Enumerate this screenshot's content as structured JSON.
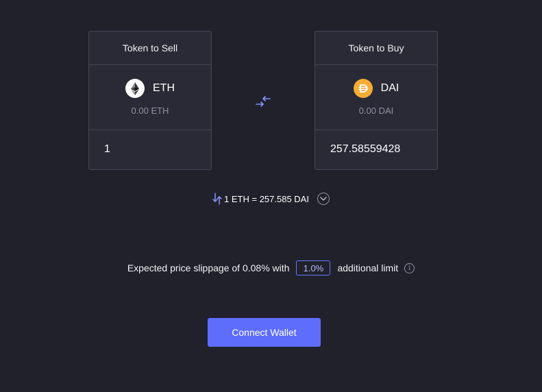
{
  "sell": {
    "header": "Token to Sell",
    "symbol": "ETH",
    "balance": "0.00 ETH",
    "amount": "1",
    "icon": "ethereum-logo-icon"
  },
  "buy": {
    "header": "Token to Buy",
    "symbol": "DAI",
    "balance": "0.00 DAI",
    "amount": "257.58559428",
    "icon": "dai-logo-icon"
  },
  "swap": {
    "icon": "swap-arrows-icon"
  },
  "rate": {
    "text": "1 ETH = 257.585 DAI",
    "flip_icon": "swap-vertical-icon",
    "expand_icon": "chevron-down-icon"
  },
  "slippage": {
    "prefix": "Expected price slippage of 0.08% with",
    "limit_value": "1.0%",
    "suffix": "additional limit",
    "info_icon": "info-icon"
  },
  "connect_button": "Connect Wallet",
  "colors": {
    "background": "#20212b",
    "card": "#292a35",
    "border": "#444656",
    "accent": "#5f6dfc",
    "muted_text": "#8e91a3",
    "eth_logo_bg": "#ffffff",
    "dai_logo_bg": "#f5ac37"
  }
}
